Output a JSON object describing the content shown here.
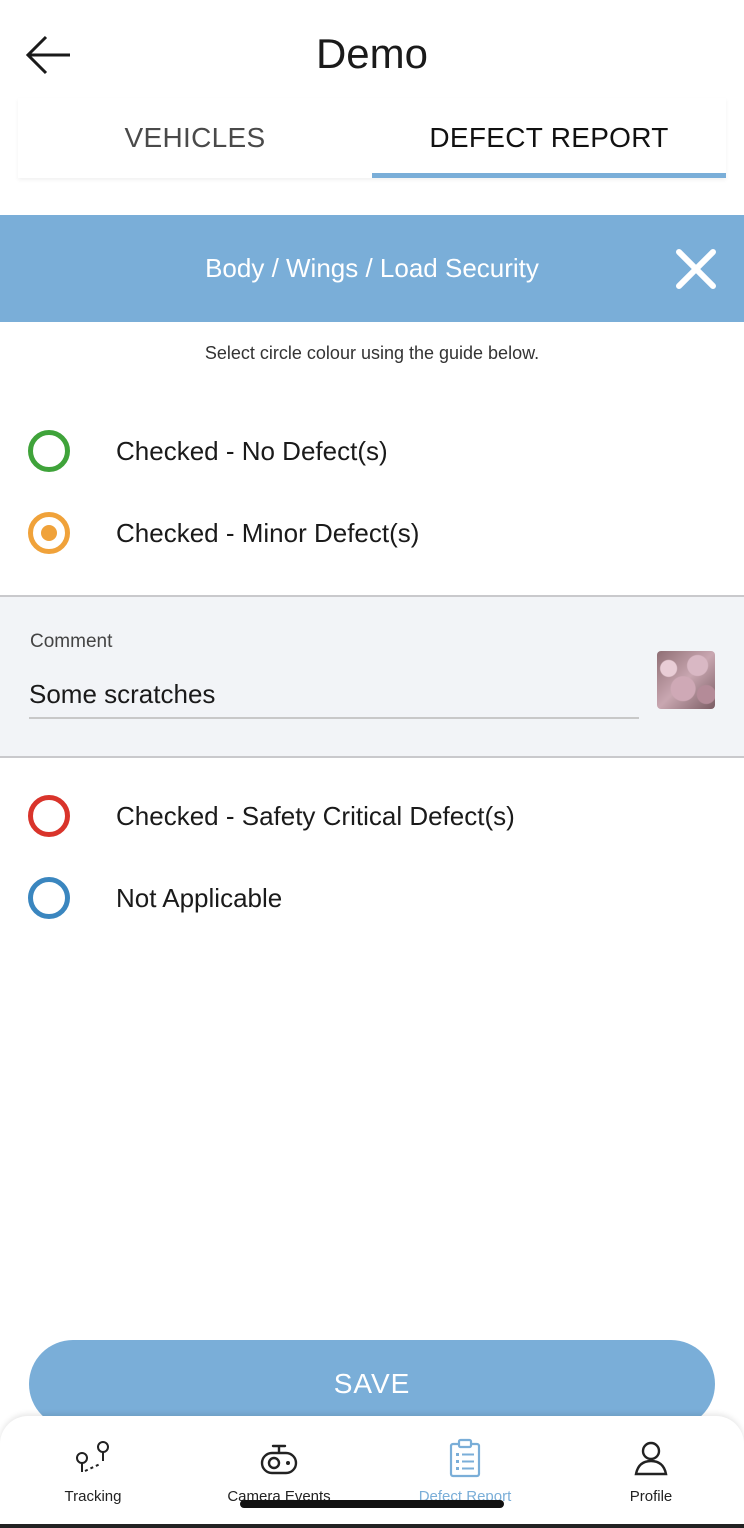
{
  "header": {
    "title": "Demo"
  },
  "tabs": [
    {
      "label": "VEHICLES",
      "active": false
    },
    {
      "label": "DEFECT REPORT",
      "active": true
    }
  ],
  "section": {
    "title": "Body / Wings / Load Security"
  },
  "guide": {
    "text": "Select circle colour using the guide below."
  },
  "options": [
    {
      "label": "Checked - No Defect(s)",
      "color": "#3fa33a",
      "selected": false
    },
    {
      "label": "Checked - Minor Defect(s)",
      "color": "#f0a23a",
      "selected": true
    },
    {
      "label": "Checked - Safety Critical Defect(s)",
      "color": "#d9342b",
      "selected": false
    },
    {
      "label": "Not Applicable",
      "color": "#3a86bf",
      "selected": false
    }
  ],
  "comment": {
    "label": "Comment",
    "value": "Some scratches"
  },
  "save": {
    "label": "SAVE"
  },
  "nav": [
    {
      "label": "Tracking",
      "icon": "tracking-icon"
    },
    {
      "label": "Camera Events",
      "icon": "camera-icon"
    },
    {
      "label": "Defect Report",
      "icon": "clipboard-icon",
      "active": true
    },
    {
      "label": "Profile",
      "icon": "profile-icon"
    }
  ],
  "colors": {
    "accent": "#7aaed8",
    "panel": "#f2f4f7"
  }
}
